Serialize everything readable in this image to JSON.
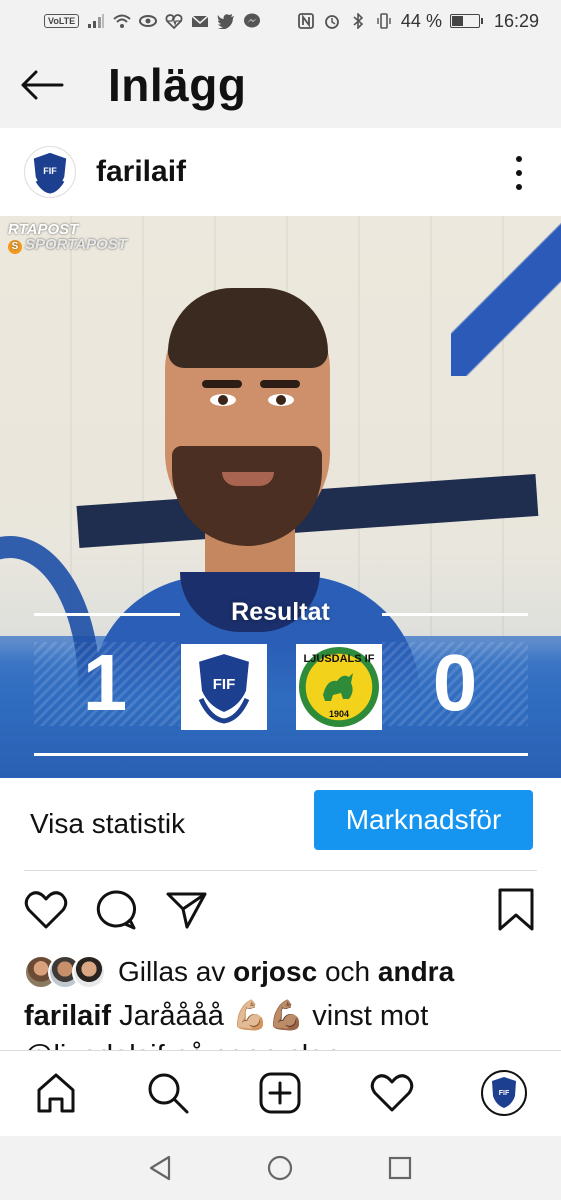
{
  "status_bar": {
    "volte": "VoLTE",
    "battery_percent": "44 %",
    "battery_level": 0.44,
    "time": "16:29",
    "left_icons": [
      "signal-icon",
      "wifi-icon",
      "eye-icon",
      "heartbeat-icon",
      "mail-icon",
      "twitter-icon",
      "messenger-icon"
    ],
    "right_icons": [
      "nfc-icon",
      "alarm-icon",
      "bluetooth-icon",
      "vibrate-icon",
      "battery-icon"
    ]
  },
  "header": {
    "title": "Inlägg",
    "back_icon": "arrow-left-icon"
  },
  "post": {
    "username": "farilaif",
    "more_icon": "more-vertical-icon",
    "image": {
      "watermark_top": "RTAPOST",
      "watermark_brand": "SPORTAPOST",
      "result_label": "Resultat",
      "home_score": "1",
      "away_score": "0",
      "home_club": "FIF",
      "away_club": "LJUSDALS IF",
      "away_club_year": "1904",
      "colors": {
        "blue": "#2b5fb7",
        "ljusdal_green": "#2e8b3a",
        "ljusdal_yellow": "#f2d21b"
      }
    },
    "insights": {
      "view_stats": "Visa statistik",
      "promote": "Marknadsför"
    },
    "actions": [
      "heart-icon",
      "comment-icon",
      "send-icon",
      "bookmark-icon"
    ],
    "likes": {
      "prefix": "Gillas av ",
      "first_user": "orjosc",
      "middle": " och ",
      "others": "andra"
    },
    "caption": {
      "username": "farilaif",
      "text": " Jaråååå 💪🏼💪🏽 vinst mot",
      "second_line": "@ljusdalsif på egen plan"
    }
  },
  "bottom_nav": [
    "home-icon",
    "search-icon",
    "add-post-icon",
    "activity-heart-icon",
    "profile-avatar"
  ],
  "system_nav": [
    "back-triangle-icon",
    "home-circle-icon",
    "recents-square-icon"
  ],
  "colors": {
    "accent": "#1595f0",
    "bar_bg": "#f2f2f2"
  }
}
